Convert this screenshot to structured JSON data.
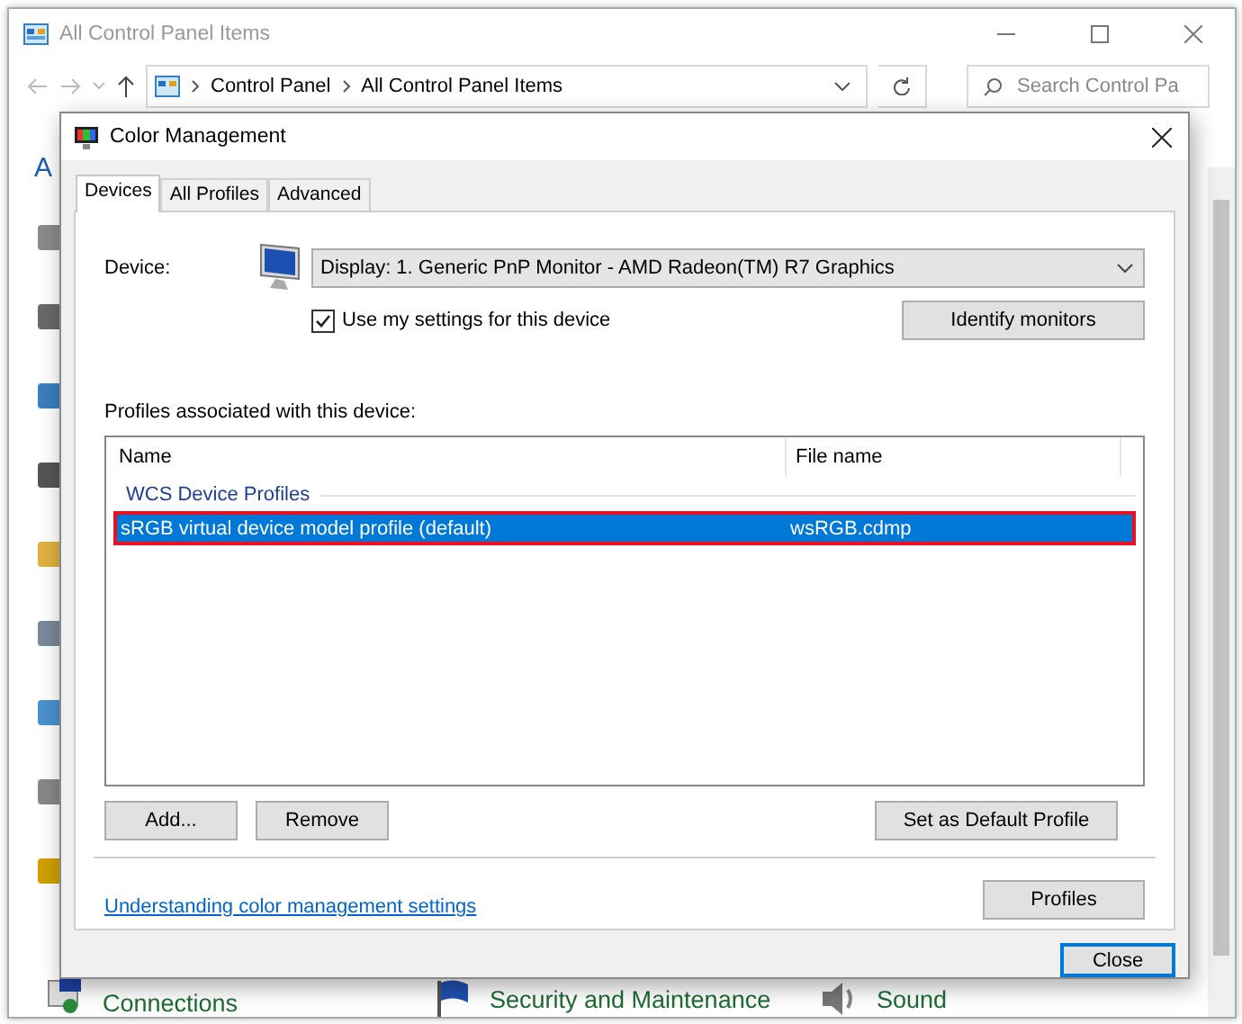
{
  "window": {
    "title": "All Control Panel Items",
    "breadcrumb": [
      "Control Panel",
      "All Control Panel Items"
    ],
    "search": {
      "placeholder": "Search Control Pa"
    },
    "side_link": "A",
    "items": [
      {
        "label": "Connections"
      },
      {
        "label": "Security and Maintenance"
      },
      {
        "label": "Sound"
      }
    ]
  },
  "dialog": {
    "title": "Color Management",
    "tabs": [
      {
        "label": "Devices",
        "selected": true
      },
      {
        "label": "All Profiles",
        "selected": false
      },
      {
        "label": "Advanced",
        "selected": false
      }
    ],
    "device_label": "Device:",
    "device_value": "Display: 1. Generic PnP Monitor - AMD Radeon(TM) R7 Graphics",
    "use_settings": {
      "label": "Use my settings for this device",
      "checked": true
    },
    "identify_button": "Identify monitors",
    "profiles_label": "Profiles associated with this device:",
    "columns": [
      "Name",
      "File name"
    ],
    "group": "WCS Device Profiles",
    "rows": [
      {
        "name": "sRGB virtual device model profile (default)",
        "file": "wsRGB.cdmp",
        "selected": true
      }
    ],
    "buttons": [
      "Add...",
      "Remove"
    ],
    "default_button": "Set as Default Profile",
    "link": "Understanding color management settings",
    "profiles_button": "Profiles",
    "close_button": "Close"
  }
}
